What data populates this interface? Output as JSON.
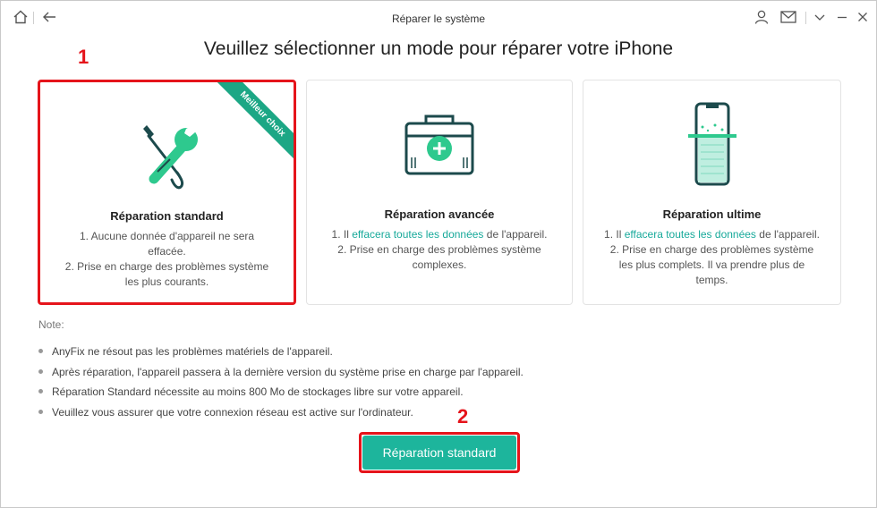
{
  "window": {
    "title": "Réparer le système"
  },
  "titlebar_icons": [
    "home-icon",
    "back-arrow-icon",
    "user-icon",
    "mail-icon",
    "chevron-down-icon",
    "minimize-icon",
    "close-icon"
  ],
  "main": {
    "title": "Veuillez sélectionner un mode pour réparer votre iPhone"
  },
  "annotations": {
    "step1": "1",
    "step2": "2",
    "color": "#e5141b"
  },
  "accent_color": "#1db59c",
  "cards": [
    {
      "title": "Réparation standard",
      "badge": "Meilleur choix",
      "icon": "wrench-screwdriver-icon",
      "selected": true,
      "line1": "1. Aucune donnée d'appareil ne sera effacée.",
      "line2": "2. Prise en charge des problèmes système les plus courants."
    },
    {
      "title": "Réparation avancée",
      "icon": "first-aid-kit-icon",
      "line1_pre": "1. Il ",
      "line1_hl": "effacera toutes les données",
      "line1_post": " de l'appareil.",
      "line2": "2. Prise en charge des problèmes système complexes."
    },
    {
      "title": "Réparation ultime",
      "icon": "phone-scan-icon",
      "line1_pre": "1. Il ",
      "line1_hl": "effacera toutes les données",
      "line1_post": " de l'appareil.",
      "line2": "2. Prise en charge des problèmes système les plus complets. Il va prendre plus de temps."
    }
  ],
  "notes": {
    "label": "Note:",
    "items": [
      "AnyFix ne résout pas les problèmes matériels de l'appareil.",
      "Après réparation, l'appareil passera à la dernière version du système prise en charge par l'appareil.",
      "Réparation Standard nécessite au moins 800 Mo de stockages libre sur votre appareil.",
      "Veuillez vous assurer que votre connexion réseau est active sur l'ordinateur."
    ]
  },
  "action_button": {
    "label": "Réparation standard"
  }
}
